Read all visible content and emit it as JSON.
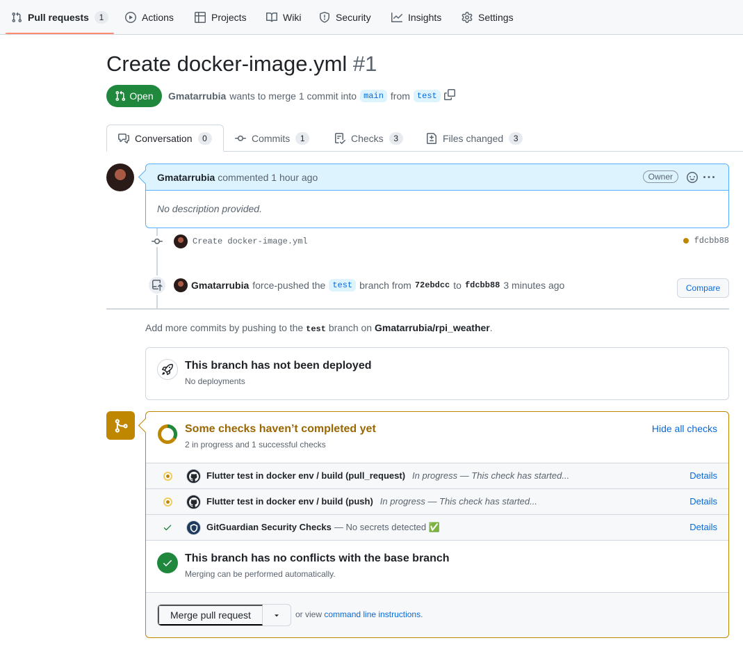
{
  "nav": {
    "items": [
      {
        "label": "Pull requests",
        "count": "1",
        "icon": "git-pull-request-icon"
      },
      {
        "label": "Actions",
        "icon": "play-icon"
      },
      {
        "label": "Projects",
        "icon": "table-icon"
      },
      {
        "label": "Wiki",
        "icon": "book-icon"
      },
      {
        "label": "Security",
        "icon": "shield-icon"
      },
      {
        "label": "Insights",
        "icon": "graph-icon"
      },
      {
        "label": "Settings",
        "icon": "gear-icon"
      }
    ],
    "active_color": "#fd8c73"
  },
  "pr": {
    "title": "Create docker-image.yml",
    "number": "#1",
    "state": "Open",
    "state_color": "#1f883d",
    "author": "Gmatarrubia",
    "merge_text": "wants to merge 1 commit into",
    "base_branch": "main",
    "from_text": "from",
    "head_branch": "test"
  },
  "tabs": [
    {
      "label": "Conversation",
      "count": "0",
      "icon": "comment-discussion-icon"
    },
    {
      "label": "Commits",
      "count": "1",
      "icon": "git-commit-icon"
    },
    {
      "label": "Checks",
      "count": "3",
      "icon": "checklist-icon"
    },
    {
      "label": "Files changed",
      "count": "3",
      "icon": "file-diff-icon"
    }
  ],
  "comment": {
    "author": "Gmatarrubia",
    "action": "commented 1 hour ago",
    "badge": "Owner",
    "body": "No description provided."
  },
  "commit": {
    "message": "Create docker-image.yml",
    "sha": "fdcbb88"
  },
  "force_push": {
    "author": "Gmatarrubia",
    "text1": "force-pushed the",
    "branch": "test",
    "text2": "branch from",
    "from_sha": "72ebdcc",
    "text3": "to",
    "to_sha": "fdcbb88",
    "time": "3 minutes ago",
    "compare_label": "Compare"
  },
  "hint": {
    "prefix": "Add more commits by pushing to the",
    "branch": "test",
    "middle": "branch on",
    "repo": "Gmatarrubia/rpi_weather",
    "suffix": "."
  },
  "deploy": {
    "title": "This branch has not been deployed",
    "subtitle": "No deployments"
  },
  "checks": {
    "title": "Some checks haven’t completed yet",
    "subtitle": "2 in progress and 1 successful checks",
    "hide_label": "Hide all checks",
    "accent": "#bf8700",
    "items": [
      {
        "name": "Flutter test in docker env / build (pull_request)",
        "status_text": "In progress — This check has started...",
        "state": "in_progress",
        "details": "Details"
      },
      {
        "name": "Flutter test in docker env / build (push)",
        "status_text": "In progress — This check has started...",
        "state": "in_progress",
        "details": "Details"
      },
      {
        "name": "GitGuardian Security Checks",
        "status_text": "— No secrets detected ✅",
        "state": "success",
        "details": "Details"
      }
    ]
  },
  "conflicts": {
    "title": "This branch has no conflicts with the base branch",
    "subtitle": "Merging can be performed automatically."
  },
  "merge": {
    "button_label": "Merge pull request",
    "note_prefix": "or view",
    "note_link": "command line instructions",
    "note_suffix": "."
  }
}
